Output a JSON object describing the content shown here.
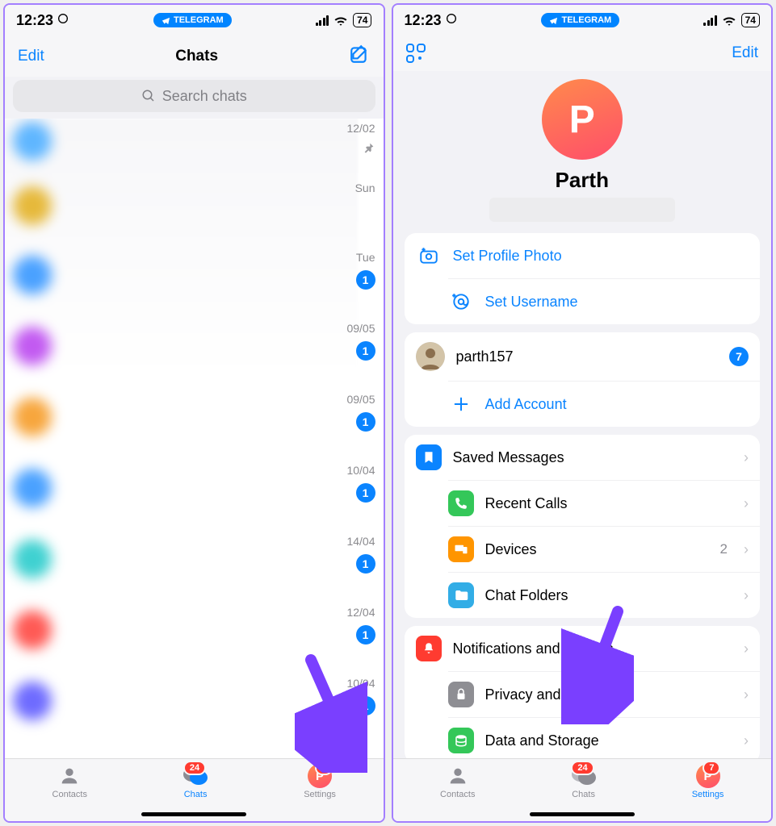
{
  "statusbar": {
    "time": "12:23",
    "pill_label": "TELEGRAM",
    "battery": "74"
  },
  "left": {
    "nav": {
      "edit": "Edit",
      "title": "Chats"
    },
    "search": {
      "placeholder": "Search chats"
    },
    "chats_strip": [
      {
        "date": "12/02",
        "pinned": true
      },
      {
        "date": "Sun"
      },
      {
        "date": "Tue",
        "badge": "1"
      },
      {
        "date": "09/05",
        "badge": "1"
      },
      {
        "date": "09/05",
        "badge": "1"
      },
      {
        "date": "10/04",
        "badge": "1"
      },
      {
        "date": "14/04",
        "badge": "1"
      },
      {
        "date": "12/04",
        "badge": "1"
      },
      {
        "date": "10/04",
        "badge": "1"
      }
    ],
    "tabs": {
      "contacts": "Contacts",
      "chats": "Chats",
      "chats_badge": "24",
      "settings": "Settings",
      "settings_badge": "7",
      "settings_initial": "P"
    }
  },
  "right": {
    "nav": {
      "edit": "Edit"
    },
    "profile": {
      "initial": "P",
      "name": "Parth"
    },
    "actions": {
      "set_photo": "Set Profile Photo",
      "set_username": "Set Username"
    },
    "accounts": {
      "current": "parth157",
      "current_badge": "7",
      "add": "Add Account"
    },
    "menu1": {
      "saved": "Saved Messages",
      "recent": "Recent Calls",
      "devices": "Devices",
      "devices_count": "2",
      "folders": "Chat Folders"
    },
    "menu2": {
      "notif": "Notifications and Sounds",
      "privacy": "Privacy and Security",
      "data": "Data and Storage"
    },
    "tabs": {
      "contacts": "Contacts",
      "chats": "Chats",
      "chats_badge": "24",
      "settings": "Settings",
      "settings_badge": "7",
      "settings_initial": "P"
    }
  }
}
